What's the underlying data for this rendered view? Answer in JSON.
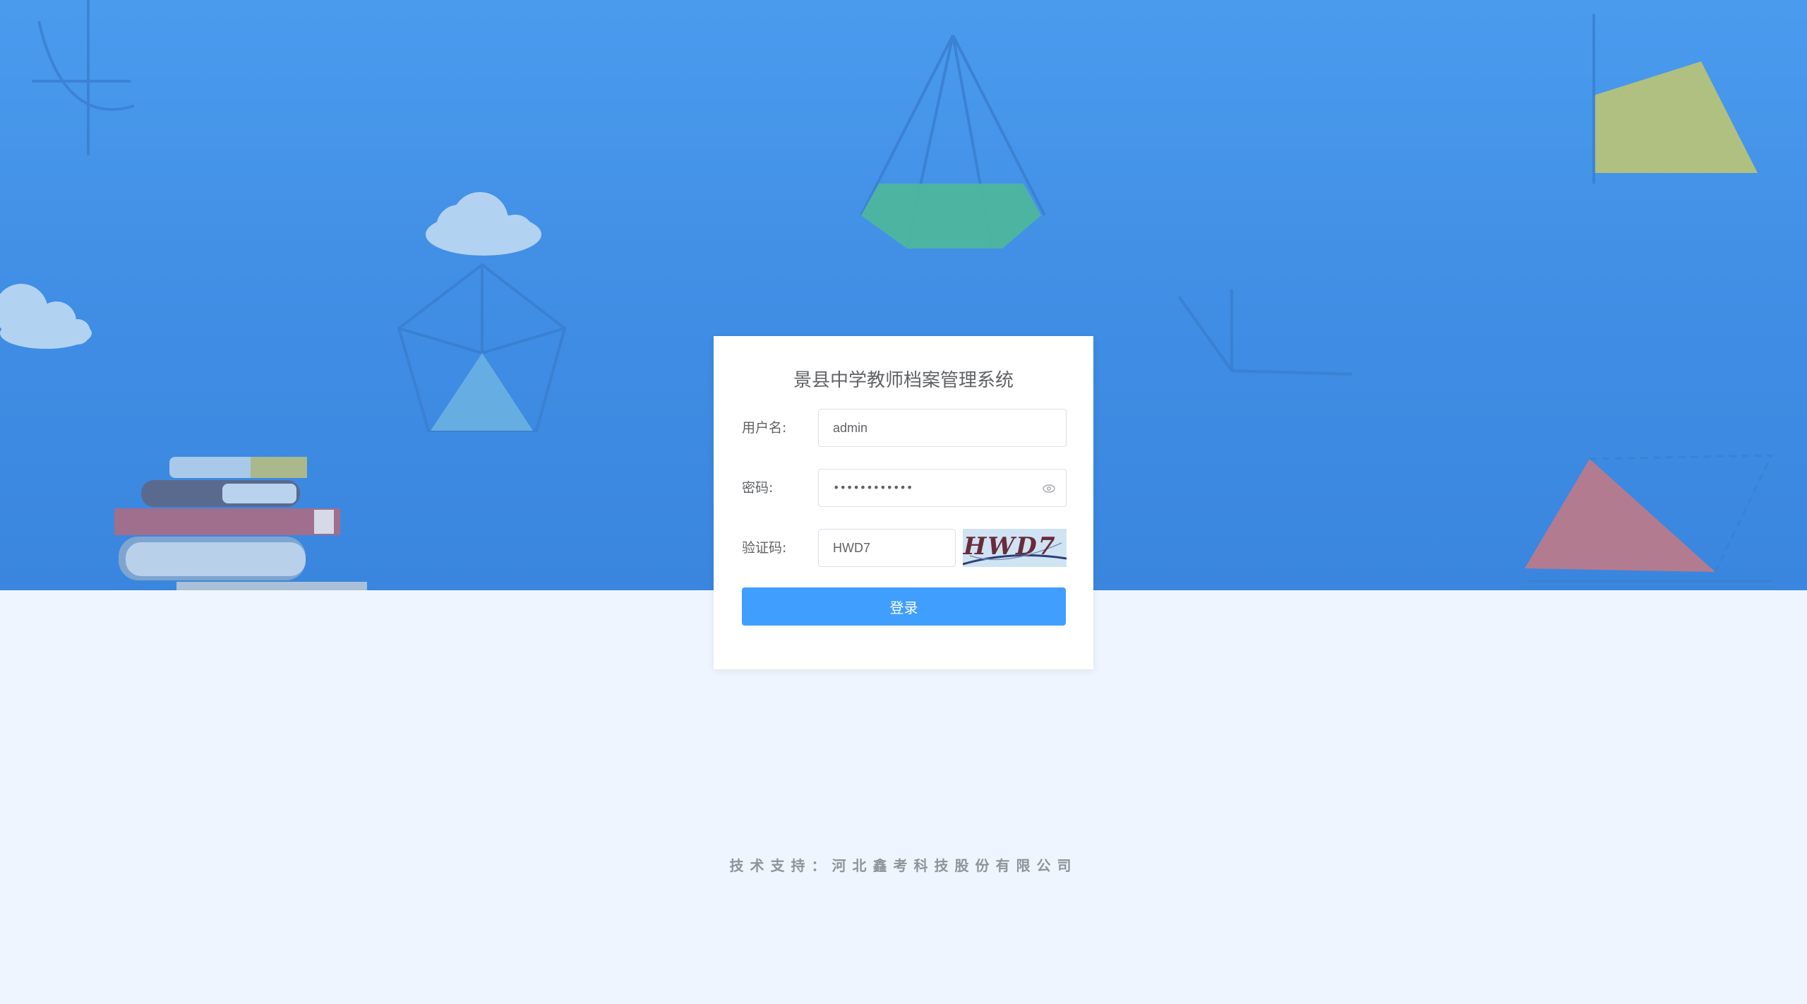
{
  "login": {
    "title": "景县中学教师档案管理系统",
    "username_label": "用户名:",
    "username_value": "admin",
    "password_label": "密码:",
    "password_mask": "••••••••••••",
    "captcha_label": "验证码:",
    "captcha_value": "HWD7",
    "captcha_image_text": "HWD7",
    "submit_label": "登录"
  },
  "footer": {
    "support_text": "技术支持：河北鑫考科技股份有限公司"
  },
  "theme": {
    "primary": "#409eff",
    "hero_top": "#4a9bee",
    "page_bg": "#eef5fe"
  }
}
